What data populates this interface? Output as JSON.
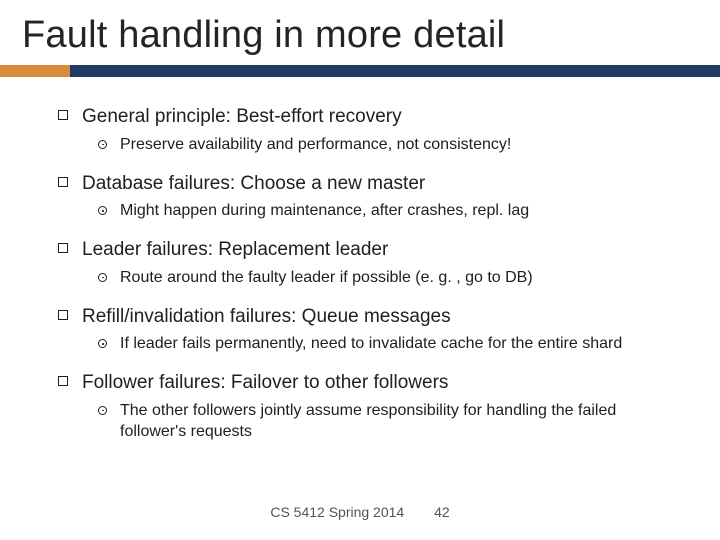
{
  "title": "Fault handling in more detail",
  "bullets": {
    "b1": "General principle: Best-effort recovery",
    "b1a": "Preserve availability and performance, not consistency!",
    "b2": "Database failures: Choose a new master",
    "b2a": "Might happen during maintenance, after crashes, repl. lag",
    "b3": "Leader failures: Replacement leader",
    "b3a": "Route around the faulty leader if possible (e. g. , go to DB)",
    "b4": "Refill/invalidation failures: Queue messages",
    "b4a": "If leader fails permanently, need to invalidate cache for the entire shard",
    "b5": "Follower failures: Failover to other followers",
    "b5a": "The other followers jointly assume responsibility for handling the failed follower's requests"
  },
  "footer": {
    "course": "CS 5412 Spring 2014",
    "page": "42"
  }
}
